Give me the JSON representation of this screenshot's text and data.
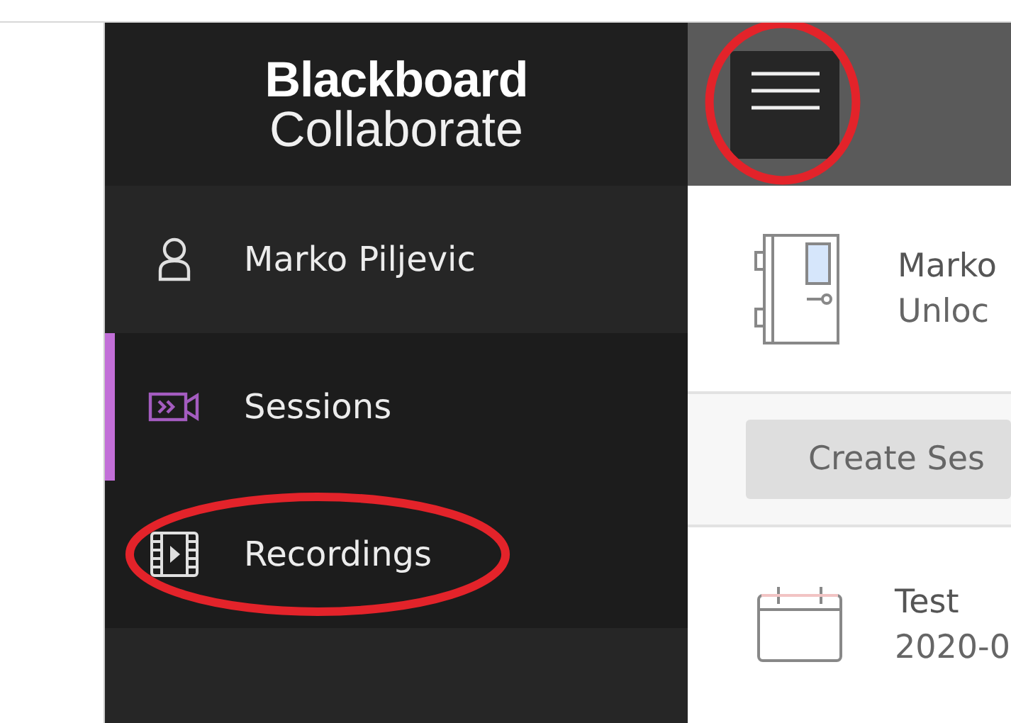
{
  "sidebar": {
    "logo": {
      "line_1": "Blackboard",
      "line_2": "Collaborate"
    },
    "items": [
      {
        "kind": "user",
        "label": "Marko Piljevic",
        "selected": false,
        "circled": false
      },
      {
        "kind": "sessions",
        "label": "Sessions",
        "selected": true,
        "circled": false
      },
      {
        "kind": "recordings",
        "label": "Recordings",
        "selected": false,
        "circled": true
      }
    ]
  },
  "header": {
    "menu_button": {
      "circled": true
    }
  },
  "room": {
    "title": "Marko",
    "status": "Unloc"
  },
  "create_button": {
    "label": "Create Ses"
  },
  "sessions": [
    {
      "title": "Test",
      "date": "2020-0"
    }
  ]
}
